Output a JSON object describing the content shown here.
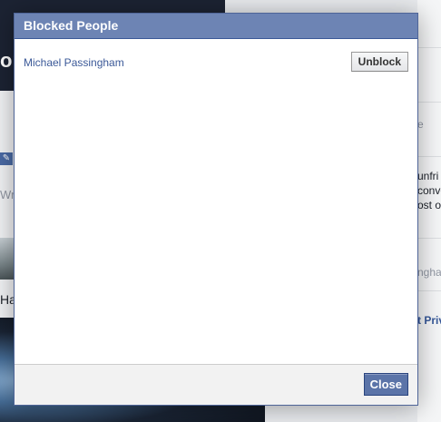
{
  "background": {
    "cover_text": "or",
    "write_fragment": "Wri",
    "edit_icon": "pencil-icon",
    "ha_fragment": "Ha",
    "right_fragments": [
      "e",
      "unfri",
      "conve",
      "ost or",
      "ngha",
      "t Priv"
    ]
  },
  "dialog": {
    "title": "Blocked People",
    "blocked_people": [
      {
        "name": "Michael Passingham",
        "action_label": "Unblock"
      }
    ],
    "close_label": "Close"
  },
  "colors": {
    "header_bg": "#6d84b4",
    "link": "#3b5998",
    "close_bg": "#5b74a8"
  }
}
